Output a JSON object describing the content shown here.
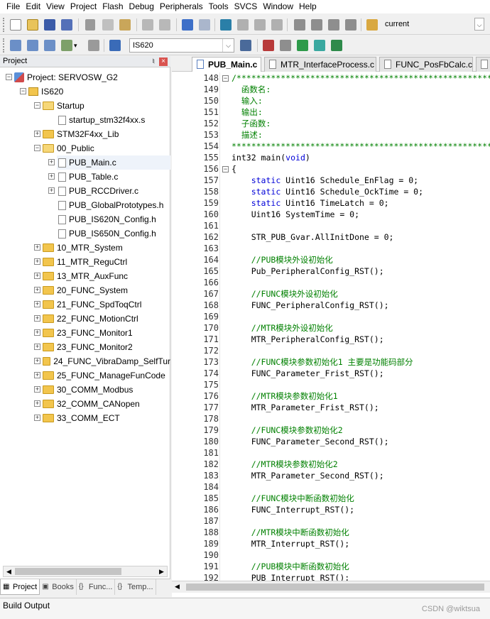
{
  "menu": [
    "File",
    "Edit",
    "View",
    "Project",
    "Flash",
    "Debug",
    "Peripherals",
    "Tools",
    "SVCS",
    "Window",
    "Help"
  ],
  "toolbar": {
    "find_combo_value": "current",
    "target_combo_value": "IS620"
  },
  "project_panel": {
    "title": "Project",
    "tree": [
      {
        "label": "Project: SERVOSW_G2",
        "level": 0,
        "kind": "project",
        "expander": "−"
      },
      {
        "label": "IS620",
        "level": 1,
        "kind": "target",
        "expander": "−"
      },
      {
        "label": "Startup",
        "level": 2,
        "kind": "folder-open",
        "expander": "−"
      },
      {
        "label": "startup_stm32f4xx.s",
        "level": 3,
        "kind": "file",
        "expander": ""
      },
      {
        "label": "STM32F4xx_Lib",
        "level": 2,
        "kind": "folder",
        "expander": "+"
      },
      {
        "label": "00_Public",
        "level": 2,
        "kind": "folder-open",
        "expander": "−"
      },
      {
        "label": "PUB_Main.c",
        "level": 3,
        "kind": "file",
        "expander": "+"
      },
      {
        "label": "PUB_Table.c",
        "level": 3,
        "kind": "file",
        "expander": "+"
      },
      {
        "label": "PUB_RCCDriver.c",
        "level": 3,
        "kind": "file",
        "expander": "+"
      },
      {
        "label": "PUB_GlobalPrototypes.h",
        "level": 3,
        "kind": "file",
        "expander": ""
      },
      {
        "label": "PUB_IS620N_Config.h",
        "level": 3,
        "kind": "file",
        "expander": ""
      },
      {
        "label": "PUB_IS650N_Config.h",
        "level": 3,
        "kind": "file",
        "expander": ""
      },
      {
        "label": "10_MTR_System",
        "level": 2,
        "kind": "folder",
        "expander": "+"
      },
      {
        "label": "11_MTR_ReguCtrl",
        "level": 2,
        "kind": "folder",
        "expander": "+"
      },
      {
        "label": "13_MTR_AuxFunc",
        "level": 2,
        "kind": "folder",
        "expander": "+"
      },
      {
        "label": "20_FUNC_System",
        "level": 2,
        "kind": "folder",
        "expander": "+"
      },
      {
        "label": "21_FUNC_SpdToqCtrl",
        "level": 2,
        "kind": "folder",
        "expander": "+"
      },
      {
        "label": "22_FUNC_MotionCtrl",
        "level": 2,
        "kind": "folder",
        "expander": "+"
      },
      {
        "label": "23_FUNC_Monitor1",
        "level": 2,
        "kind": "folder",
        "expander": "+"
      },
      {
        "label": "23_FUNC_Monitor2",
        "level": 2,
        "kind": "folder",
        "expander": "+"
      },
      {
        "label": "24_FUNC_VibraDamp_SelfTur",
        "level": 2,
        "kind": "folder",
        "expander": "+"
      },
      {
        "label": "25_FUNC_ManageFunCode",
        "level": 2,
        "kind": "folder",
        "expander": "+"
      },
      {
        "label": "30_COMM_Modbus",
        "level": 2,
        "kind": "folder",
        "expander": "+"
      },
      {
        "label": "32_COMM_CANopen",
        "level": 2,
        "kind": "folder",
        "expander": "+"
      },
      {
        "label": "33_COMM_ECT",
        "level": 2,
        "kind": "folder",
        "expander": "+"
      }
    ],
    "tabs": [
      {
        "label": "Project",
        "icon": "project-icon",
        "active": true
      },
      {
        "label": "Books",
        "icon": "books-icon",
        "active": false
      },
      {
        "label": "Func...",
        "icon": "braces-icon",
        "active": false
      },
      {
        "label": "Temp...",
        "icon": "template-icon",
        "active": false
      }
    ]
  },
  "editor": {
    "tabs": [
      "PUB_Main.c",
      "MTR_InterfaceProcess.c",
      "FUNC_PosFbCalc.c"
    ],
    "active_tab": "PUB_Main.c",
    "lines": [
      {
        "n": "148",
        "fold": "−",
        "segs": [
          [
            "st",
            "/*******************************************************"
          ]
        ]
      },
      {
        "n": "149",
        "fold": "",
        "segs": [
          [
            "cm",
            "  函数名:"
          ]
        ]
      },
      {
        "n": "150",
        "fold": "",
        "segs": [
          [
            "cm",
            "  输入:"
          ]
        ]
      },
      {
        "n": "151",
        "fold": "",
        "segs": [
          [
            "cm",
            "  输出:"
          ]
        ]
      },
      {
        "n": "152",
        "fold": "",
        "segs": [
          [
            "cm",
            "  子函数:"
          ]
        ]
      },
      {
        "n": "153",
        "fold": "",
        "segs": [
          [
            "cm",
            "  描述:"
          ]
        ]
      },
      {
        "n": "154",
        "fold": "",
        "segs": [
          [
            "st",
            "********************************************************"
          ]
        ]
      },
      {
        "n": "155",
        "fold": "",
        "segs": [
          [
            "tx",
            "int32 main("
          ],
          [
            "kw",
            "void"
          ],
          [
            "tx",
            ")"
          ]
        ]
      },
      {
        "n": "156",
        "fold": "−",
        "segs": [
          [
            "tx",
            "{"
          ]
        ]
      },
      {
        "n": "157",
        "fold": "",
        "segs": [
          [
            "tx",
            "    "
          ],
          [
            "kw",
            "static"
          ],
          [
            "tx",
            " Uint16 Schedule_EnFlag = 0;"
          ]
        ]
      },
      {
        "n": "158",
        "fold": "",
        "segs": [
          [
            "tx",
            "    "
          ],
          [
            "kw",
            "static"
          ],
          [
            "tx",
            " Uint16 Schedule_OckTime = 0;"
          ]
        ]
      },
      {
        "n": "159",
        "fold": "",
        "segs": [
          [
            "tx",
            "    "
          ],
          [
            "kw",
            "static"
          ],
          [
            "tx",
            " Uint16 TimeLatch = 0;"
          ]
        ]
      },
      {
        "n": "160",
        "fold": "",
        "segs": [
          [
            "tx",
            "    Uint16 SystemTime = 0;"
          ]
        ]
      },
      {
        "n": "161",
        "fold": "",
        "segs": [
          [
            "tx",
            ""
          ]
        ]
      },
      {
        "n": "162",
        "fold": "",
        "segs": [
          [
            "tx",
            "    STR_PUB_Gvar.AllInitDone = 0;"
          ]
        ]
      },
      {
        "n": "163",
        "fold": "",
        "segs": [
          [
            "tx",
            ""
          ]
        ]
      },
      {
        "n": "164",
        "fold": "",
        "segs": [
          [
            "cm",
            "    //PUB模块外设初始化"
          ]
        ]
      },
      {
        "n": "165",
        "fold": "",
        "segs": [
          [
            "tx",
            "    Pub_PeripheralConfig_RST();"
          ]
        ]
      },
      {
        "n": "166",
        "fold": "",
        "segs": [
          [
            "tx",
            ""
          ]
        ]
      },
      {
        "n": "167",
        "fold": "",
        "segs": [
          [
            "cm",
            "    //FUNC模块外设初始化"
          ]
        ]
      },
      {
        "n": "168",
        "fold": "",
        "segs": [
          [
            "tx",
            "    FUNC_PeripheralConfig_RST();"
          ]
        ]
      },
      {
        "n": "169",
        "fold": "",
        "segs": [
          [
            "tx",
            ""
          ]
        ]
      },
      {
        "n": "170",
        "fold": "",
        "segs": [
          [
            "cm",
            "    //MTR模块外设初始化"
          ]
        ]
      },
      {
        "n": "171",
        "fold": "",
        "segs": [
          [
            "tx",
            "    MTR_PeripheralConfig_RST();"
          ]
        ]
      },
      {
        "n": "172",
        "fold": "",
        "segs": [
          [
            "tx",
            ""
          ]
        ]
      },
      {
        "n": "173",
        "fold": "",
        "segs": [
          [
            "cm",
            "    //FUNC模块参数初始化1 主要是功能码部分"
          ]
        ]
      },
      {
        "n": "174",
        "fold": "",
        "segs": [
          [
            "tx",
            "    FUNC_Parameter_Frist_RST();"
          ]
        ]
      },
      {
        "n": "175",
        "fold": "",
        "segs": [
          [
            "tx",
            ""
          ]
        ]
      },
      {
        "n": "176",
        "fold": "",
        "segs": [
          [
            "cm",
            "    //MTR模块参数初始化1"
          ]
        ]
      },
      {
        "n": "177",
        "fold": "",
        "segs": [
          [
            "tx",
            "    MTR_Parameter_Frist_RST();"
          ]
        ]
      },
      {
        "n": "178",
        "fold": "",
        "segs": [
          [
            "tx",
            ""
          ]
        ]
      },
      {
        "n": "179",
        "fold": "",
        "segs": [
          [
            "cm",
            "    //FUNC模块参数初始化2"
          ]
        ]
      },
      {
        "n": "180",
        "fold": "",
        "segs": [
          [
            "tx",
            "    FUNC_Parameter_Second_RST();"
          ]
        ]
      },
      {
        "n": "181",
        "fold": "",
        "segs": [
          [
            "tx",
            ""
          ]
        ]
      },
      {
        "n": "182",
        "fold": "",
        "segs": [
          [
            "cm",
            "    //MTR模块参数初始化2"
          ]
        ]
      },
      {
        "n": "183",
        "fold": "",
        "segs": [
          [
            "tx",
            "    MTR_Parameter_Second_RST();"
          ]
        ]
      },
      {
        "n": "184",
        "fold": "",
        "segs": [
          [
            "tx",
            ""
          ]
        ]
      },
      {
        "n": "185",
        "fold": "",
        "segs": [
          [
            "cm",
            "    //FUNC模块中断函数初始化"
          ]
        ]
      },
      {
        "n": "186",
        "fold": "",
        "segs": [
          [
            "tx",
            "    FUNC_Interrupt_RST();"
          ]
        ]
      },
      {
        "n": "187",
        "fold": "",
        "segs": [
          [
            "tx",
            ""
          ]
        ]
      },
      {
        "n": "188",
        "fold": "",
        "segs": [
          [
            "cm",
            "    //MTR模块中断函数初始化"
          ]
        ]
      },
      {
        "n": "189",
        "fold": "",
        "segs": [
          [
            "tx",
            "    MTR_Interrupt_RST();"
          ]
        ]
      },
      {
        "n": "190",
        "fold": "",
        "segs": [
          [
            "tx",
            ""
          ]
        ]
      },
      {
        "n": "191",
        "fold": "",
        "segs": [
          [
            "cm",
            "    //PUB模块中断函数初始化"
          ]
        ]
      },
      {
        "n": "192",
        "fold": "",
        "segs": [
          [
            "tx",
            "    PUB_Interrupt_RST();"
          ]
        ]
      }
    ]
  },
  "bottom": {
    "title": "Build Output",
    "watermark": "CSDN @wiktsua"
  },
  "colors": {
    "keyword": "#0000d8",
    "comment": "#008000",
    "folder": "#f2c54d",
    "tab_bg": "#e4e4e4"
  }
}
